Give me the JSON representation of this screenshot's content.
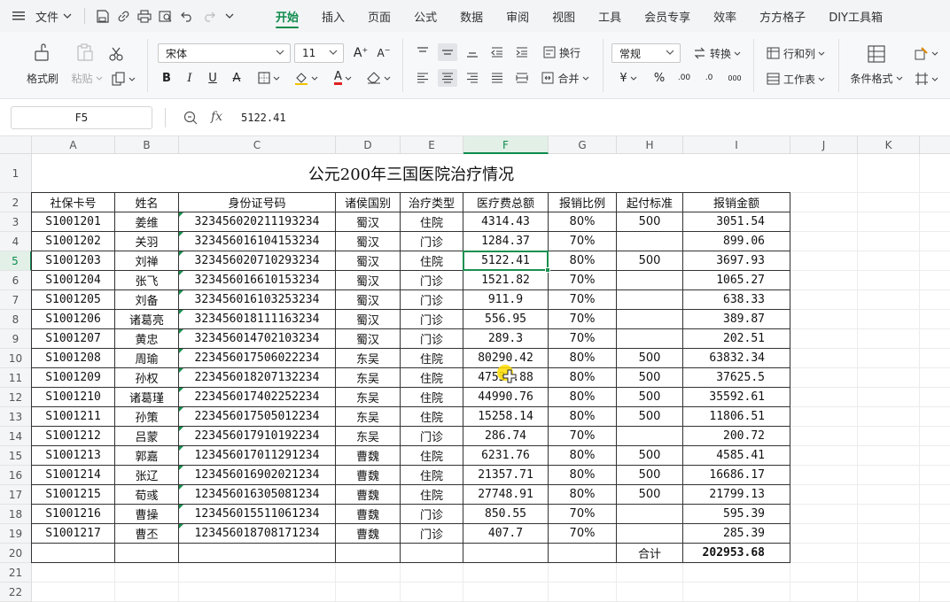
{
  "menubar": {
    "file_label": "文件",
    "tabs": [
      {
        "label": "开始",
        "active": true
      },
      {
        "label": "插入",
        "active": false
      },
      {
        "label": "页面",
        "active": false
      },
      {
        "label": "公式",
        "active": false
      },
      {
        "label": "数据",
        "active": false
      },
      {
        "label": "审阅",
        "active": false
      },
      {
        "label": "视图",
        "active": false
      },
      {
        "label": "工具",
        "active": false
      },
      {
        "label": "会员专享",
        "active": false
      },
      {
        "label": "效率",
        "active": false
      },
      {
        "label": "方方格子",
        "active": false
      },
      {
        "label": "DIY工具箱",
        "active": false
      }
    ]
  },
  "ribbon": {
    "format_painter": "格式刷",
    "paste": "粘贴",
    "font_name": "宋体",
    "font_size": "11",
    "wrap_text": "换行",
    "merge": "合并",
    "number_format": "常规",
    "convert": "转换",
    "rows_cols": "行和列",
    "worksheet": "工作表",
    "conditional_format": "条件格式",
    "currency_symbol": "¥",
    "percent_symbol": "%"
  },
  "formula_bar": {
    "name_box": "F5",
    "fx": "fx",
    "content": "5122.41"
  },
  "accent_color": "#0f8b4d",
  "sheet": {
    "columns": [
      "A",
      "B",
      "C",
      "D",
      "E",
      "F",
      "G",
      "H",
      "I",
      "J",
      "K"
    ],
    "row_numbers": [
      "1",
      "2",
      "3",
      "4",
      "5",
      "6",
      "7",
      "8",
      "9",
      "10",
      "11",
      "12",
      "13",
      "14",
      "15",
      "16",
      "17",
      "18",
      "19",
      "20",
      "21",
      "22"
    ],
    "selected_cell": "F5",
    "title": "公元200年三国医院治疗情况",
    "headers": [
      "社保卡号",
      "姓名",
      "身份证号码",
      "诸侯国别",
      "治疗类型",
      "医疗费总额",
      "报销比例",
      "起付标准",
      "报销金额"
    ],
    "rows": [
      [
        "S1001201",
        "姜维",
        "323456020211193234",
        "蜀汉",
        "住院",
        "4314.43",
        "80%",
        "500",
        "3051.54"
      ],
      [
        "S1001202",
        "关羽",
        "323456016104153234",
        "蜀汉",
        "门诊",
        "1284.37",
        "70%",
        "",
        "899.06"
      ],
      [
        "S1001203",
        "刘禅",
        "323456020710293234",
        "蜀汉",
        "住院",
        "5122.41",
        "80%",
        "500",
        "3697.93"
      ],
      [
        "S1001204",
        "张飞",
        "323456016610153234",
        "蜀汉",
        "门诊",
        "1521.82",
        "70%",
        "",
        "1065.27"
      ],
      [
        "S1001205",
        "刘备",
        "323456016103253234",
        "蜀汉",
        "门诊",
        "911.9",
        "70%",
        "",
        "638.33"
      ],
      [
        "S1001206",
        "诸葛亮",
        "323456018111163234",
        "蜀汉",
        "门诊",
        "556.95",
        "70%",
        "",
        "389.87"
      ],
      [
        "S1001207",
        "黄忠",
        "323456014702103234",
        "蜀汉",
        "门诊",
        "289.3",
        "70%",
        "",
        "202.51"
      ],
      [
        "S1001208",
        "周瑜",
        "223456017506022234",
        "东吴",
        "住院",
        "80290.42",
        "80%",
        "500",
        "63832.34"
      ],
      [
        "S1001209",
        "孙权",
        "223456018207132234",
        "东吴",
        "住院",
        "47531.88",
        "80%",
        "500",
        "37625.5"
      ],
      [
        "S1001210",
        "诸葛瑾",
        "223456017402252234",
        "东吴",
        "住院",
        "44990.76",
        "80%",
        "500",
        "35592.61"
      ],
      [
        "S1001211",
        "孙策",
        "223456017505012234",
        "东吴",
        "住院",
        "15258.14",
        "80%",
        "500",
        "11806.51"
      ],
      [
        "S1001212",
        "吕蒙",
        "223456017910192234",
        "东吴",
        "门诊",
        "286.74",
        "70%",
        "",
        "200.72"
      ],
      [
        "S1001213",
        "郭嘉",
        "123456017011291234",
        "曹魏",
        "住院",
        "6231.76",
        "80%",
        "500",
        "4585.41"
      ],
      [
        "S1001214",
        "张辽",
        "123456016902021234",
        "曹魏",
        "住院",
        "21357.71",
        "80%",
        "500",
        "16686.17"
      ],
      [
        "S1001215",
        "荀彧",
        "123456016305081234",
        "曹魏",
        "住院",
        "27748.91",
        "80%",
        "500",
        "21799.13"
      ],
      [
        "S1001216",
        "曹操",
        "123456015511061234",
        "曹魏",
        "门诊",
        "850.55",
        "70%",
        "",
        "595.39"
      ],
      [
        "S1001217",
        "曹丕",
        "123456018708171234",
        "曹魏",
        "门诊",
        "407.7",
        "70%",
        "",
        "285.39"
      ]
    ],
    "total_label": "合计",
    "total_value": "202953.68"
  }
}
